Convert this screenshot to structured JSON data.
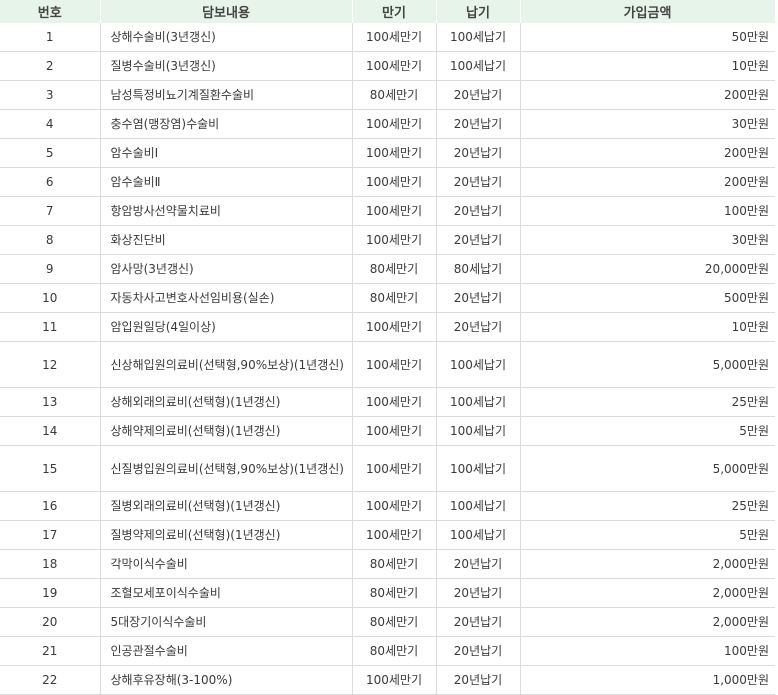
{
  "headers": [
    "번호",
    "담보내용",
    "만기",
    "납기",
    "가입금액"
  ],
  "rows": [
    {
      "no": "1",
      "name": "상해수술비(3년갱신)",
      "maturity": "100세만기",
      "payment": "100세납기",
      "amount": "50만원"
    },
    {
      "no": "2",
      "name": "질병수술비(3년갱신)",
      "maturity": "100세만기",
      "payment": "100세납기",
      "amount": "10만원"
    },
    {
      "no": "3",
      "name": "남성특정비뇨기계질환수술비",
      "maturity": "80세만기",
      "payment": "20년납기",
      "amount": "200만원"
    },
    {
      "no": "4",
      "name": "충수염(맹장염)수술비",
      "maturity": "100세만기",
      "payment": "20년납기",
      "amount": "30만원"
    },
    {
      "no": "5",
      "name": "암수술비Ⅰ",
      "maturity": "100세만기",
      "payment": "20년납기",
      "amount": "200만원"
    },
    {
      "no": "6",
      "name": "암수술비Ⅱ",
      "maturity": "100세만기",
      "payment": "20년납기",
      "amount": "200만원"
    },
    {
      "no": "7",
      "name": "항암방사선약물치료비",
      "maturity": "100세만기",
      "payment": "20년납기",
      "amount": "100만원"
    },
    {
      "no": "8",
      "name": "화상진단비",
      "maturity": "100세만기",
      "payment": "20년납기",
      "amount": "30만원"
    },
    {
      "no": "9",
      "name": "암사망(3년갱신)",
      "maturity": "80세만기",
      "payment": "80세납기",
      "amount": "20,000만원"
    },
    {
      "no": "10",
      "name": "자동차사고변호사선임비용(실손)",
      "maturity": "80세만기",
      "payment": "20년납기",
      "amount": "500만원"
    },
    {
      "no": "11",
      "name": "암입원일당(4일이상)",
      "maturity": "100세만기",
      "payment": "20년납기",
      "amount": "10만원"
    },
    {
      "no": "12",
      "name": "신상해입원의료비(선택형,90%보상)(1년갱신)",
      "maturity": "100세만기",
      "payment": "100세납기",
      "amount": "5,000만원",
      "tall": true
    },
    {
      "no": "13",
      "name": "상해외래의료비(선택형)(1년갱신)",
      "maturity": "100세만기",
      "payment": "100세납기",
      "amount": "25만원"
    },
    {
      "no": "14",
      "name": "상해약제의료비(선택형)(1년갱신)",
      "maturity": "100세만기",
      "payment": "100세납기",
      "amount": "5만원"
    },
    {
      "no": "15",
      "name": "신질병입원의료비(선택형,90%보상)(1년갱신)",
      "maturity": "100세만기",
      "payment": "100세납기",
      "amount": "5,000만원",
      "tall": true
    },
    {
      "no": "16",
      "name": "질병외래의료비(선택형)(1년갱신)",
      "maturity": "100세만기",
      "payment": "100세납기",
      "amount": "25만원"
    },
    {
      "no": "17",
      "name": "질병약제의료비(선택형)(1년갱신)",
      "maturity": "100세만기",
      "payment": "100세납기",
      "amount": "5만원"
    },
    {
      "no": "18",
      "name": "각막이식수술비",
      "maturity": "80세만기",
      "payment": "20년납기",
      "amount": "2,000만원"
    },
    {
      "no": "19",
      "name": "조혈모세포이식수술비",
      "maturity": "80세만기",
      "payment": "20년납기",
      "amount": "2,000만원"
    },
    {
      "no": "20",
      "name": "5대장기이식수술비",
      "maturity": "80세만기",
      "payment": "20년납기",
      "amount": "2,000만원"
    },
    {
      "no": "21",
      "name": "인공관절수술비",
      "maturity": "80세만기",
      "payment": "20년납기",
      "amount": "100만원"
    },
    {
      "no": "22",
      "name": "상해후유장해(3-100%)",
      "maturity": "100세만기",
      "payment": "20년납기",
      "amount": "1,000만원"
    }
  ]
}
